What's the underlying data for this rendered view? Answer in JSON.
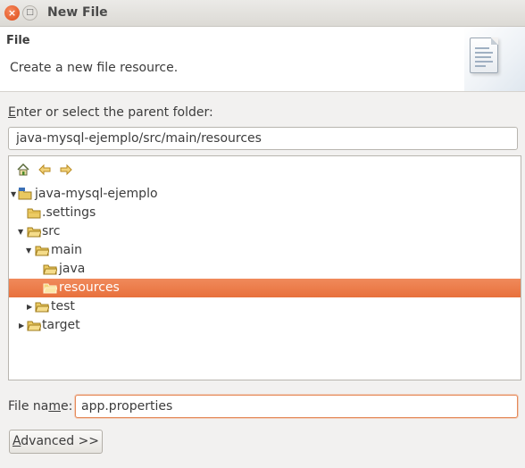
{
  "window": {
    "title": "New File",
    "close_glyph": "×",
    "minimize_glyph": "□"
  },
  "header": {
    "title": "File",
    "description": "Create a new file resource.",
    "banner_icon": "new-file-wizard-icon"
  },
  "parent_folder": {
    "label_mnemonic": "E",
    "label_rest": "nter or select the parent folder:",
    "value": "java-mysql-ejemplo/src/main/resources"
  },
  "tree_toolbar": {
    "icons": [
      "home-icon",
      "back-arrow-icon",
      "forward-arrow-icon"
    ]
  },
  "tree": {
    "items": [
      {
        "label": "java-mysql-ejemplo",
        "expanded": true,
        "type": "project"
      },
      {
        "label": ".settings",
        "type": "folder"
      },
      {
        "label": "src",
        "expanded": true,
        "type": "folder"
      },
      {
        "label": "main",
        "expanded": true,
        "type": "folder"
      },
      {
        "label": "java",
        "type": "folder"
      },
      {
        "label": "resources",
        "type": "folder",
        "selected": true
      },
      {
        "label": "test",
        "expanded": false,
        "type": "folder"
      },
      {
        "label": "target",
        "expanded": false,
        "type": "folder"
      }
    ]
  },
  "file_name": {
    "label_before": "File na",
    "label_mnemonic": "m",
    "label_after": "e:",
    "value": "app.properties"
  },
  "advanced_button": {
    "label_mnemonic": "A",
    "label_rest": "dvanced >>"
  },
  "colors": {
    "selection": "#e8703c",
    "close_button": "#df4a16",
    "folder": "#e0b040"
  }
}
